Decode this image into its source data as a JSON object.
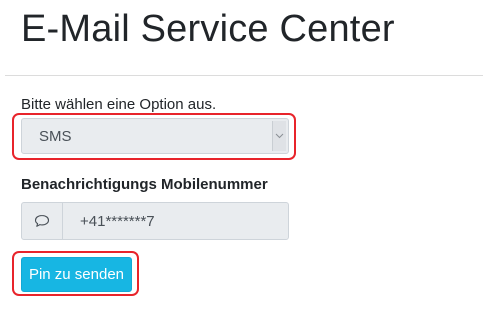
{
  "page": {
    "title": "E-Mail Service Center"
  },
  "form": {
    "option_label": "Bitte wählen eine Option aus.",
    "option_select": {
      "selected": "SMS"
    },
    "mobile_label": "Benachrichtigungs Mobilenummer",
    "mobile_input": {
      "value": "+41*******7",
      "icon": "speech-bubble-icon"
    },
    "submit_label": "Pin zu senden"
  },
  "colors": {
    "accent": "#17b6e3",
    "highlight": "#e8242b",
    "disabled_bg": "#e9ecef"
  }
}
